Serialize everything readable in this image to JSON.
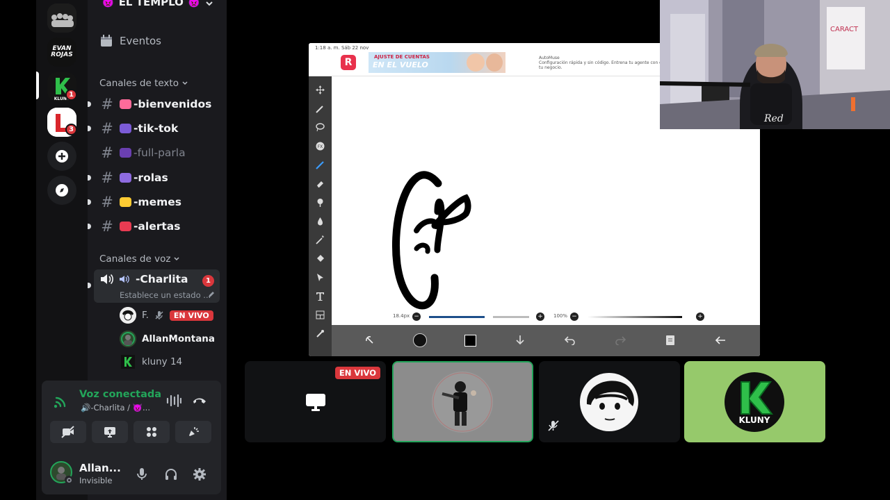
{
  "server": {
    "name": "EL TEMPLO"
  },
  "rail": {
    "servers": [
      {
        "label": "EVAN ROJAS"
      },
      {
        "label": "KLUNY",
        "badge": "1"
      },
      {
        "label": "L",
        "badge": "3"
      }
    ]
  },
  "sidebar": {
    "events_label": "Eventos",
    "text_category": "Canales de texto",
    "text_channels": [
      {
        "name": "-bienvenidos",
        "unread": true,
        "muted": false,
        "emoji_color": "#ff6b9a"
      },
      {
        "name": "-tik-tok",
        "unread": true,
        "muted": false,
        "emoji_color": "#7b5bd6"
      },
      {
        "name": "-full-parla",
        "unread": false,
        "muted": true,
        "emoji_color": "#6a3fb0"
      },
      {
        "name": "-rolas",
        "unread": true,
        "muted": false,
        "emoji_color": "#8e6be0"
      },
      {
        "name": "-memes",
        "unread": true,
        "muted": false,
        "emoji_color": "#ffcc33"
      },
      {
        "name": "-alertas",
        "unread": true,
        "muted": false,
        "emoji_color": "#e83b52"
      }
    ],
    "voice_category": "Canales de voz",
    "voice_channel": {
      "name": "-Charlita",
      "status": "Establece un estado ...",
      "badge": "1"
    },
    "members": [
      {
        "name": "F.",
        "live_label": "EN VIVO"
      },
      {
        "name": "AllanMontana"
      },
      {
        "name": "kluny 14"
      }
    ]
  },
  "panel": {
    "voice_connected": "Voz conectada",
    "voice_location": "🔊-Charlita / 👿...",
    "user_name": "Allan...",
    "user_status": "Invisible"
  },
  "app": {
    "status_time": "1:18 a. m.  Sáb 22 nov",
    "ad_logo": "R",
    "ad_title": "AJUSTE DE CUENTAS",
    "ad_sub": "EN EL VUELO",
    "ad_text_small": "AutoMuse",
    "ad_text": "Configuración rápida y sin código. Entrena tu agente con datos de tu negocio.",
    "brush_size": "18.4px",
    "opacity": "100%"
  },
  "tiles": {
    "live_label": "EN VIVO",
    "kluny_label": "KLUNY"
  },
  "colors": {
    "accent_green": "#23a55a",
    "live_red": "#da373c",
    "kluny_green": "#96c96b"
  }
}
